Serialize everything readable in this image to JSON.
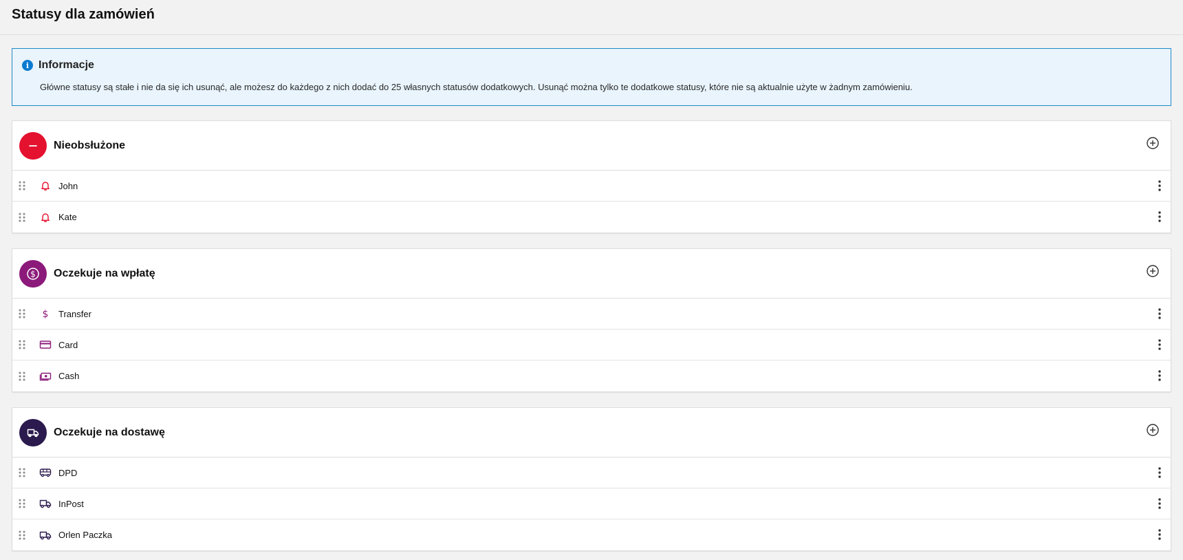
{
  "page": {
    "title": "Statusy dla zamówień"
  },
  "info": {
    "title": "Informacje",
    "text": "Główne statusy są stałe i nie da się ich usunąć, ale możesz do każdego z nich dodać do 25 własnych statusów dodatkowych. Usunąć można tylko te dodatkowe statusy, które nie są aktualnie użyte w żadnym zamówieniu.",
    "icon": "info-icon",
    "accent": "#1e88c9"
  },
  "sections": [
    {
      "title": "Nieobsłużone",
      "badge_icon": "minus-icon",
      "color": "#e4112f",
      "items": [
        {
          "label": "John",
          "icon": "bell-icon"
        },
        {
          "label": "Kate",
          "icon": "bell-icon"
        }
      ]
    },
    {
      "title": "Oczekuje na wpłatę",
      "badge_icon": "dollar-circle-icon",
      "color": "#8b1a7a",
      "items": [
        {
          "label": "Transfer",
          "icon": "dollar-icon"
        },
        {
          "label": "Card",
          "icon": "credit-card-icon"
        },
        {
          "label": "Cash",
          "icon": "cash-icon"
        }
      ]
    },
    {
      "title": "Oczekuje na dostawę",
      "badge_icon": "truck-icon",
      "color": "#2b1a4e",
      "items": [
        {
          "label": "DPD",
          "icon": "bus-icon"
        },
        {
          "label": "InPost",
          "icon": "truck-icon"
        },
        {
          "label": "Orlen Paczka",
          "icon": "truck-icon"
        }
      ]
    }
  ]
}
